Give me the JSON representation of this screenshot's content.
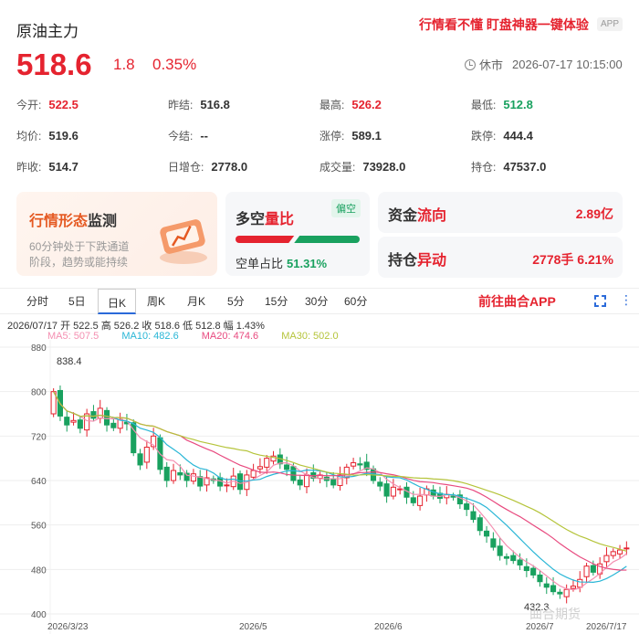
{
  "header": {
    "title": "原油主力",
    "promo": "行情看不懂 盯盘神器一键体验",
    "app_badge": "APP",
    "price": "518.6",
    "change": "1.8",
    "change_pct": "0.35%",
    "status": "休市",
    "datetime": "2026-07-17 10:15:00"
  },
  "stats": [
    {
      "label": "今开:",
      "value": "522.5",
      "color": "red"
    },
    {
      "label": "昨结:",
      "value": "516.8",
      "color": "black"
    },
    {
      "label": "最高:",
      "value": "526.2",
      "color": "red"
    },
    {
      "label": "最低:",
      "value": "512.8",
      "color": "green"
    },
    {
      "label": "均价:",
      "value": "519.6",
      "color": "black"
    },
    {
      "label": "今结:",
      "value": "--",
      "color": "black"
    },
    {
      "label": "涨停:",
      "value": "589.1",
      "color": "black"
    },
    {
      "label": "跌停:",
      "value": "444.4",
      "color": "black"
    },
    {
      "label": "昨收:",
      "value": "514.7",
      "color": "black"
    },
    {
      "label": "日增仓:",
      "value": "2778.0",
      "color": "black"
    },
    {
      "label": "成交量:",
      "value": "73928.0",
      "color": "black"
    },
    {
      "label": "持仓:",
      "value": "47537.0",
      "color": "black"
    }
  ],
  "cards": {
    "pattern": {
      "title_a": "行情形态",
      "title_b": "监测",
      "desc": "60分钟处于下跌通道阶段，趋势或能持续"
    },
    "longshort": {
      "title_a": "多空",
      "title_b": "量比",
      "tag": "偏空",
      "label": "空单占比",
      "value": "51.31%",
      "short_ratio": 0.5131
    },
    "capital": {
      "title_a": "资金",
      "title_b": "流向",
      "value": "2.89亿"
    },
    "position": {
      "title_a": "持仓",
      "title_b": "异动",
      "value": "2778手 6.21%"
    }
  },
  "tabs": {
    "items": [
      "分时",
      "5日",
      "日K",
      "周K",
      "月K",
      "5分",
      "15分",
      "30分",
      "60分"
    ],
    "active": "日K",
    "go_app": "前往曲合APP"
  },
  "chart_info": {
    "line1": "2026/07/17 开 522.5 高 526.2 收 518.6 低 512.8 幅 1.43%",
    "ma5": "MA5: 507.5",
    "ma10": "MA10: 482.6",
    "ma20": "MA20: 474.6",
    "ma30": "MA30: 502.0"
  },
  "watermark": "曲合期货",
  "chart_data": {
    "type": "candlestick",
    "y_ticks": [
      880,
      800,
      720,
      640,
      560,
      480,
      400
    ],
    "ylim": [
      400,
      880
    ],
    "x_labels": [
      "2026/3/23",
      "2026/5",
      "2026/6",
      "2026/7",
      "2026/7/17"
    ],
    "high_label": "838.4",
    "low_label": "432.3",
    "colors": {
      "up": "#e5232f",
      "down": "#19a15f",
      "ma5": "#f48fb1",
      "ma10": "#29b6d6",
      "ma20": "#e84a7f",
      "ma30": "#b5c43a"
    },
    "closes": [
      800,
      756,
      740,
      748,
      734,
      760,
      752,
      770,
      740,
      735,
      750,
      742,
      690,
      668,
      700,
      720,
      660,
      640,
      658,
      650,
      640,
      652,
      630,
      645,
      640,
      630,
      632,
      648,
      624,
      650,
      658,
      665,
      680,
      684,
      670,
      660,
      640,
      632,
      650,
      644,
      650,
      640,
      632,
      650,
      664,
      672,
      668,
      660,
      640,
      630,
      612,
      628,
      625,
      610,
      600,
      612,
      625,
      612,
      608,
      615,
      610,
      598,
      588,
      570,
      550,
      540,
      520,
      505,
      500,
      496,
      488,
      478,
      470,
      458,
      448,
      440,
      436,
      444,
      450,
      462,
      486,
      475,
      490,
      505,
      512,
      515,
      518.6
    ]
  }
}
